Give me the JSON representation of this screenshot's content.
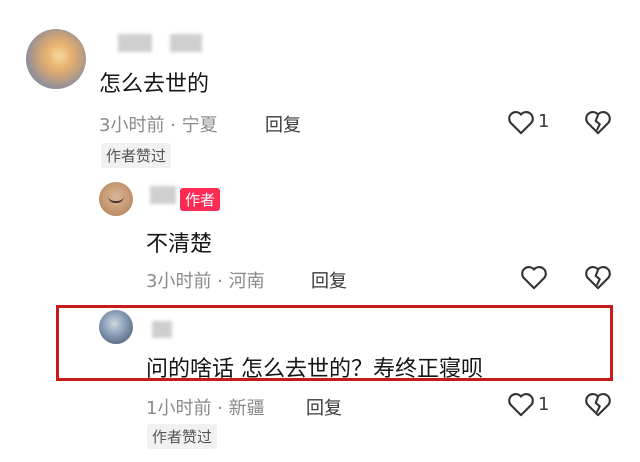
{
  "comments": [
    {
      "text": "怎么去世的",
      "time": "3小时前",
      "location": "宁夏",
      "reply_label": "回复",
      "like_count": "1",
      "chip": "作者赞过"
    },
    {
      "badge": "作者",
      "text": "不清楚",
      "time": "3小时前",
      "location": "河南",
      "reply_label": "回复"
    },
    {
      "text": "问的啥话 怎么去世的？寿终正寝呗",
      "time": "1小时前",
      "location": "新疆",
      "reply_label": "回复",
      "like_count": "1",
      "chip": "作者赞过"
    }
  ],
  "separator": "·",
  "colors": {
    "highlight": "#c81a1a",
    "author_badge": "#fe2c55"
  }
}
